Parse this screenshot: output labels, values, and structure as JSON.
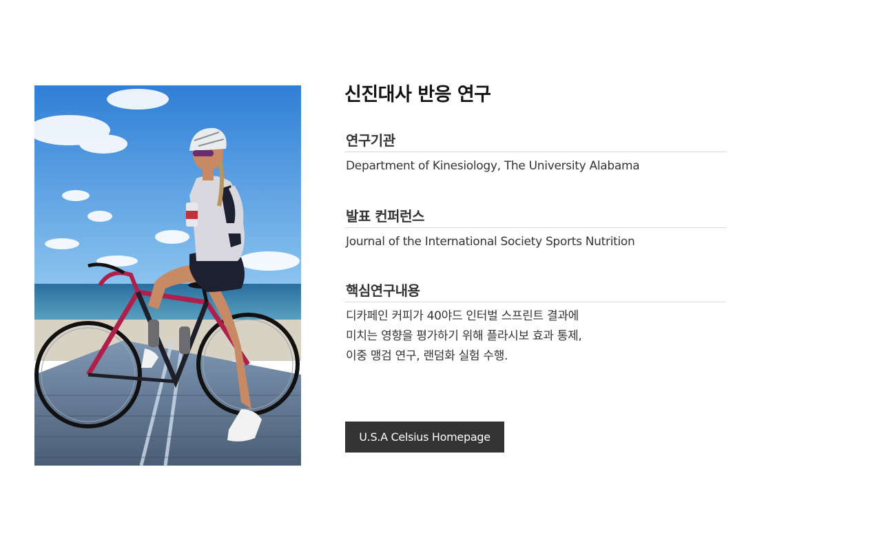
{
  "title": "신진대사 반응 연구",
  "sections": [
    {
      "heading": "연구기관",
      "lines": [
        "Department of Kinesiology, The University Alabama"
      ]
    },
    {
      "heading": "발표 컨퍼런스",
      "lines": [
        "Journal of the International Society Sports Nutrition"
      ]
    },
    {
      "heading": "핵심연구내용",
      "lines": [
        "디카페인 커피가 40야드 인터벌 스프린트 결과에",
        "미치는 영향을 평가하기 위해 플라시보 효과 통제,",
        "이중 맹검 연구, 랜덤화 실험 수행."
      ]
    }
  ],
  "cta": {
    "label": "U.S.A Celsius Homepage"
  },
  "photo": {
    "icon": "cyclist-photo",
    "colors": {
      "sky": "#4a90dc",
      "sea": "#3f8fb5",
      "boardwalk": "#5b6e86",
      "bike_frame": "#b01e4a",
      "jersey": "#d8d8de",
      "shorts": "#1c2030"
    }
  }
}
